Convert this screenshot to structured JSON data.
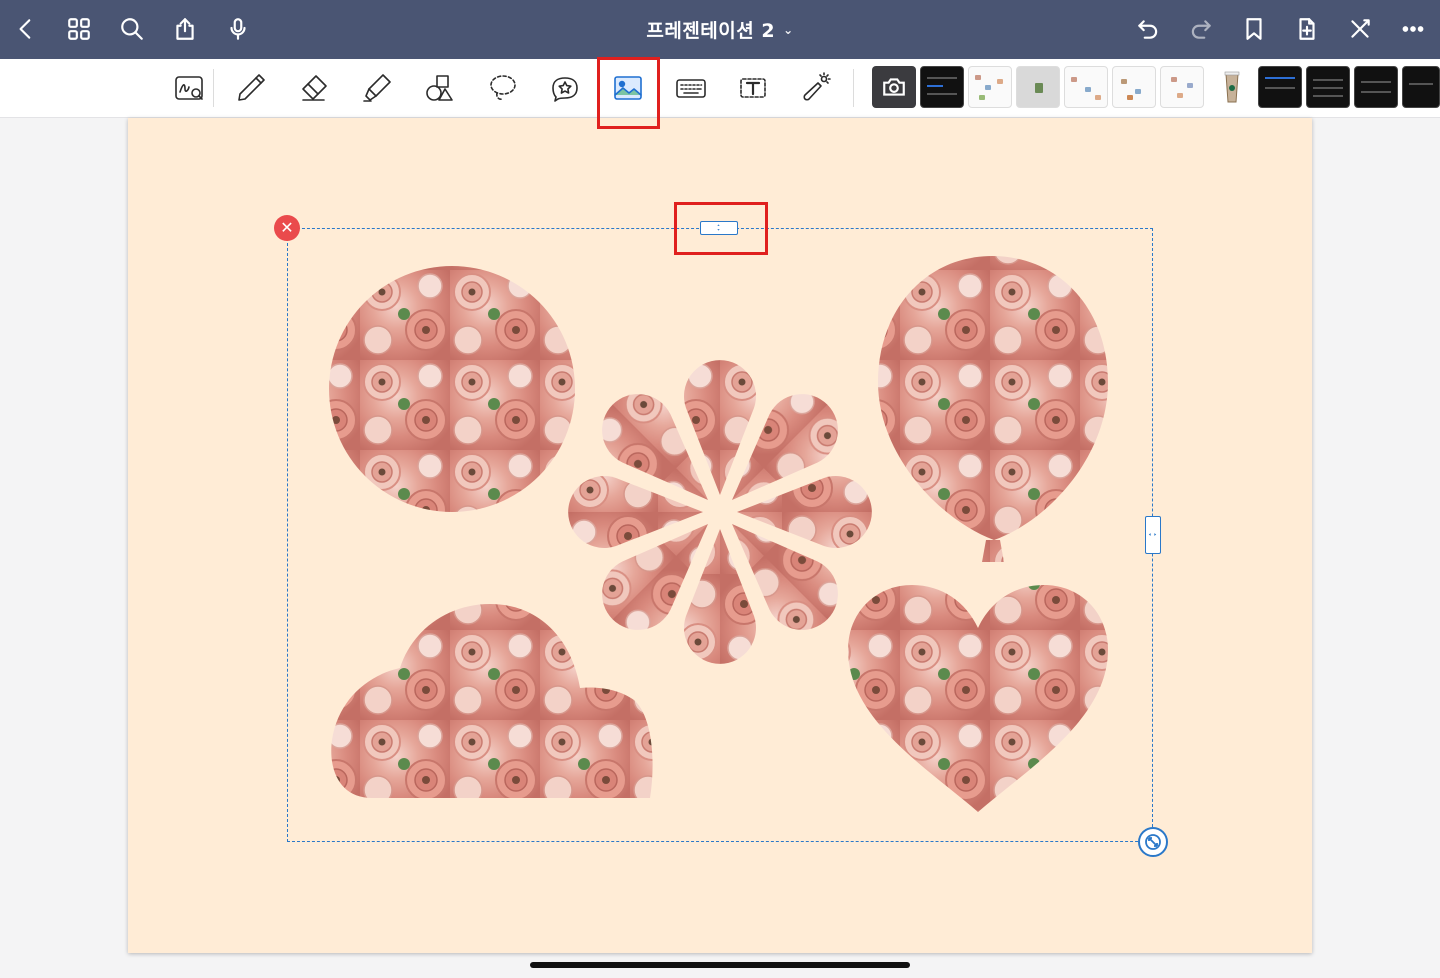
{
  "topbar": {
    "title": "프레젠테이션 2",
    "title_chevron": "⌄",
    "left_icons": [
      "back-chevron-icon",
      "grid-icon",
      "search-icon",
      "share-icon",
      "microphone-icon"
    ],
    "right_icons": [
      "undo-icon",
      "redo-icon",
      "bookmark-icon",
      "add-page-icon",
      "close-pen-icon",
      "more-icon"
    ]
  },
  "toolbar": {
    "tools": [
      "handwriting-zoom-icon",
      "pen-icon",
      "eraser-icon",
      "highlighter-icon",
      "shapes-icon",
      "lasso-icon",
      "sticker-icon",
      "image-icon",
      "keyboard-icon",
      "text-box-icon",
      "laser-pointer-icon"
    ],
    "active_tool": "image-icon",
    "recent_images": [
      "camera",
      "dark-screenshot",
      "sheet-screenshot",
      "sheet-gray-screenshot",
      "sheet-screenshot",
      "sheet-screenshot",
      "sheet-screenshot",
      "coffee-cup-photo",
      "dark-screenshot",
      "dark-screenshot",
      "dark-screenshot",
      "dark-screenshot"
    ]
  },
  "canvas": {
    "page_color": "#ffecd6",
    "shapes": [
      "circle",
      "flower",
      "balloon",
      "cloud",
      "heart"
    ],
    "selection_color": "#2a78c9"
  },
  "colors": {
    "topbar_bg": "#4a5573",
    "highlight": "#e0201e",
    "delete_handle": "#ea4a4c"
  }
}
